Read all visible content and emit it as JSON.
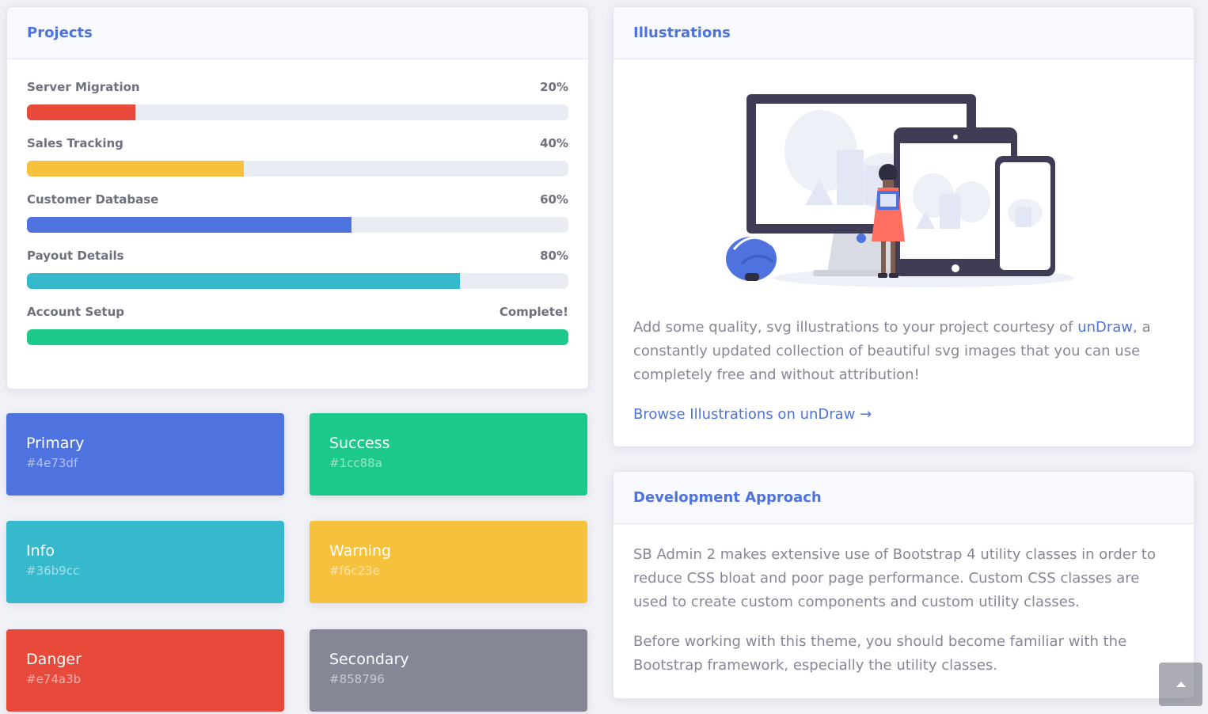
{
  "projects": {
    "title": "Projects",
    "items": [
      {
        "name": "Server Migration",
        "status": "20%",
        "progress": 0.2,
        "color": "#e74a3b"
      },
      {
        "name": "Sales Tracking",
        "status": "40%",
        "progress": 0.4,
        "color": "#f6c23e"
      },
      {
        "name": "Customer Database",
        "status": "60%",
        "progress": 0.6,
        "color": "#4e73df"
      },
      {
        "name": "Payout Details",
        "status": "80%",
        "progress": 0.8,
        "color": "#36b9cc"
      },
      {
        "name": "Account Setup",
        "status": "Complete!",
        "progress": 1.0,
        "color": "#1cc88a"
      }
    ]
  },
  "colors": [
    {
      "name": "Primary",
      "hex": "#4e73df"
    },
    {
      "name": "Success",
      "hex": "#1cc88a"
    },
    {
      "name": "Info",
      "hex": "#36b9cc"
    },
    {
      "name": "Warning",
      "hex": "#f6c23e"
    },
    {
      "name": "Danger",
      "hex": "#e74a3b"
    },
    {
      "name": "Secondary",
      "hex": "#858796"
    }
  ],
  "illustrations": {
    "title": "Illustrations",
    "text_before": "Add some quality, svg illustrations to your project courtesy of ",
    "link_text": "unDraw",
    "text_after": ", a constantly updated collection of beautiful svg images that you can use completely free and without attribution!",
    "browse_link": "Browse Illustrations on unDraw →"
  },
  "development": {
    "title": "Development Approach",
    "para1": "SB Admin 2 makes extensive use of Bootstrap 4 utility classes in order to reduce CSS bloat and poor page performance. Custom CSS classes are used to create custom components and custom utility classes.",
    "para2": "Before working with this theme, you should become familiar with the Bootstrap framework, especially the utility classes."
  },
  "scroll_top_icon": "chevron-up-icon"
}
